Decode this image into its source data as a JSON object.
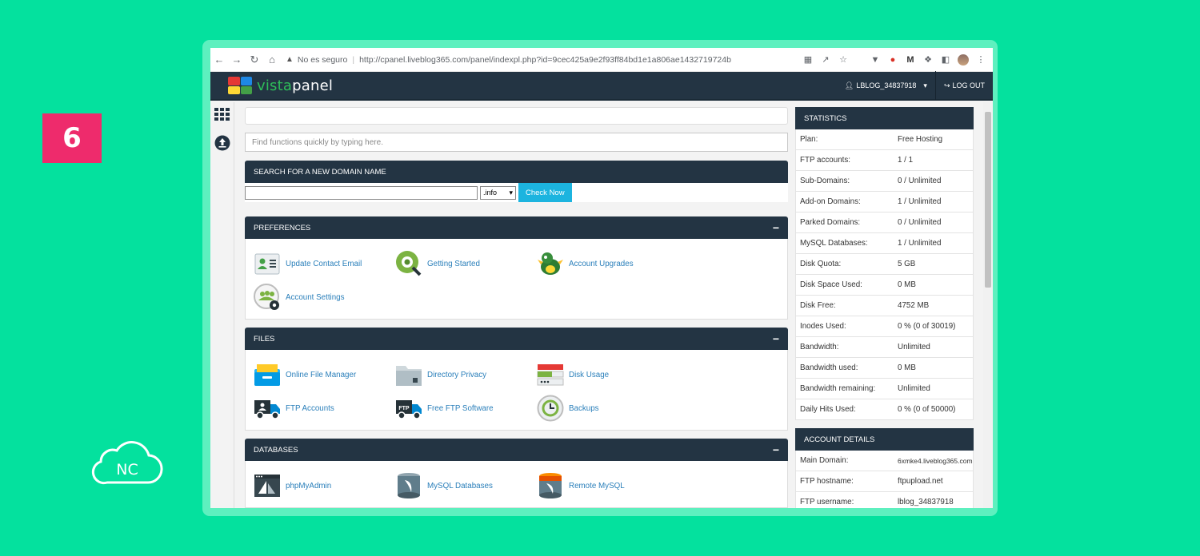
{
  "step_number": "6",
  "nc_logo_text": "NC",
  "browser": {
    "security_text": "No es seguro",
    "url": "http://cpanel.liveblog365.com/panel/indexpl.php?id=9cec425a9e2f93ff84bd1e1a806ae1432719724b"
  },
  "topnav": {
    "brand_prefix": "vista",
    "brand_suffix": "panel",
    "user_label": "LBLOG_34837918",
    "logout_label": "LOG OUT"
  },
  "search": {
    "placeholder": "Find functions quickly by typing here."
  },
  "domain_search": {
    "title": "SEARCH FOR A NEW DOMAIN NAME",
    "tld_selected": ".info",
    "button_label": "Check Now"
  },
  "preferences": {
    "title": "PREFERENCES",
    "toggle": "−",
    "items": [
      {
        "label": "Update Contact Email",
        "icon": "contact-card-icon"
      },
      {
        "label": "Getting Started",
        "icon": "getting-started-icon"
      },
      {
        "label": "Account Upgrades",
        "icon": "dragon-upgrade-icon"
      },
      {
        "label": "Account Settings",
        "icon": "account-settings-icon"
      }
    ]
  },
  "files": {
    "title": "FILES",
    "toggle": "−",
    "items": [
      {
        "label": "Online File Manager",
        "icon": "file-manager-icon"
      },
      {
        "label": "Directory Privacy",
        "icon": "folder-lock-icon"
      },
      {
        "label": "Disk Usage",
        "icon": "disk-usage-icon"
      },
      {
        "label": "FTP Accounts",
        "icon": "ftp-truck-icon"
      },
      {
        "label": "Free FTP Software",
        "icon": "ftp-software-icon"
      },
      {
        "label": "Backups",
        "icon": "backup-icon"
      }
    ]
  },
  "databases": {
    "title": "DATABASES",
    "toggle": "−",
    "items": [
      {
        "label": "phpMyAdmin",
        "icon": "phpmyadmin-icon"
      },
      {
        "label": "MySQL Databases",
        "icon": "mysql-icon"
      },
      {
        "label": "Remote MySQL",
        "icon": "remote-mysql-icon"
      }
    ]
  },
  "statistics": {
    "title": "STATISTICS",
    "rows": [
      {
        "k": "Plan:",
        "v": "Free Hosting"
      },
      {
        "k": "FTP accounts:",
        "v": "1 / 1"
      },
      {
        "k": "Sub-Domains:",
        "v": "0 / Unlimited"
      },
      {
        "k": "Add-on Domains:",
        "v": "1 / Unlimited"
      },
      {
        "k": "Parked Domains:",
        "v": "0 / Unlimited"
      },
      {
        "k": "MySQL Databases:",
        "v": "1 / Unlimited"
      },
      {
        "k": "Disk Quota:",
        "v": "5 GB"
      },
      {
        "k": "Disk Space Used:",
        "v": "0 MB"
      },
      {
        "k": "Disk Free:",
        "v": "4752 MB"
      },
      {
        "k": "Inodes Used:",
        "v": "0 % (0 of 30019)"
      },
      {
        "k": "Bandwidth:",
        "v": "Unlimited"
      },
      {
        "k": "Bandwidth used:",
        "v": "0 MB"
      },
      {
        "k": "Bandwidth remaining:",
        "v": "Unlimited"
      },
      {
        "k": "Daily Hits Used:",
        "v": "0 % (0 of 50000)"
      }
    ]
  },
  "account_details": {
    "title": "ACCOUNT DETAILS",
    "rows": [
      {
        "k": "Main Domain:",
        "v": "6xmke4.liveblog365.com"
      },
      {
        "k": "FTP hostname:",
        "v": "ftpupload.net"
      },
      {
        "k": "FTP username:",
        "v": "lblog_34837918"
      }
    ]
  }
}
